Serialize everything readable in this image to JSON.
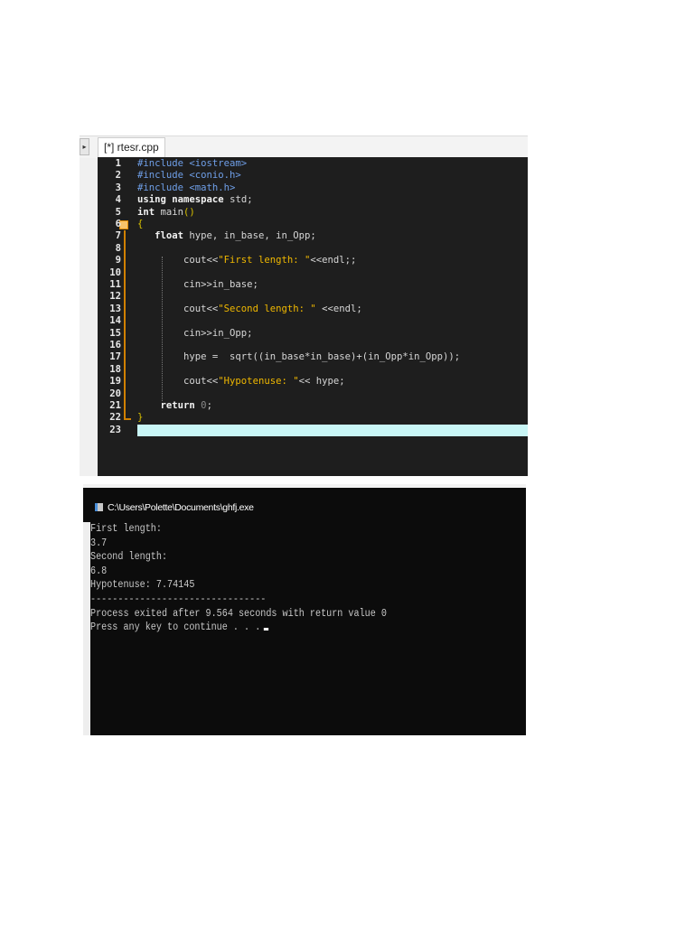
{
  "editor": {
    "tab_label": "[*] rtesr.cpp",
    "lines": [
      {
        "n": "1",
        "tokens": [
          {
            "t": "#include <iostream>",
            "c": "pp"
          }
        ]
      },
      {
        "n": "2",
        "tokens": [
          {
            "t": "#include <conio.h>",
            "c": "pp"
          }
        ]
      },
      {
        "n": "3",
        "tokens": [
          {
            "t": "#include <math.h>",
            "c": "pp"
          }
        ]
      },
      {
        "n": "4",
        "tokens": [
          {
            "t": "using namespace ",
            "c": "kw"
          },
          {
            "t": "std;",
            "c": "id"
          }
        ]
      },
      {
        "n": "5",
        "tokens": [
          {
            "t": "int ",
            "c": "kw"
          },
          {
            "t": "main",
            "c": "id"
          },
          {
            "t": "()",
            "c": "br"
          }
        ]
      },
      {
        "n": "6",
        "tokens": [
          {
            "t": "{",
            "c": "br"
          }
        ]
      },
      {
        "n": "7",
        "tokens": [
          {
            "t": "   float ",
            "c": "kw"
          },
          {
            "t": "hype, in_base, in_Opp;",
            "c": "id"
          }
        ]
      },
      {
        "n": "8",
        "tokens": []
      },
      {
        "n": "9",
        "tokens": [
          {
            "t": "        cout<<",
            "c": "id"
          },
          {
            "t": "\"First length: \"",
            "c": "str"
          },
          {
            "t": "<<endl;;",
            "c": "id"
          }
        ]
      },
      {
        "n": "10",
        "tokens": []
      },
      {
        "n": "11",
        "tokens": [
          {
            "t": "        cin>>in_base;",
            "c": "id"
          }
        ]
      },
      {
        "n": "12",
        "tokens": []
      },
      {
        "n": "13",
        "tokens": [
          {
            "t": "        cout<<",
            "c": "id"
          },
          {
            "t": "\"Second length: \"",
            "c": "str"
          },
          {
            "t": " <<endl;",
            "c": "id"
          }
        ]
      },
      {
        "n": "14",
        "tokens": []
      },
      {
        "n": "15",
        "tokens": [
          {
            "t": "        cin>>in_Opp;",
            "c": "id"
          }
        ]
      },
      {
        "n": "16",
        "tokens": []
      },
      {
        "n": "17",
        "tokens": [
          {
            "t": "        hype =  sqrt((in_base*in_base)+(in_Opp*in_Opp));",
            "c": "id"
          }
        ]
      },
      {
        "n": "18",
        "tokens": []
      },
      {
        "n": "19",
        "tokens": [
          {
            "t": "        cout<<",
            "c": "id"
          },
          {
            "t": "\"Hypotenuse: \"",
            "c": "str"
          },
          {
            "t": "<< hype;",
            "c": "id"
          }
        ]
      },
      {
        "n": "20",
        "tokens": []
      },
      {
        "n": "21",
        "tokens": [
          {
            "t": "    return ",
            "c": "kw"
          },
          {
            "t": "0",
            "c": "num"
          },
          {
            "t": ";",
            "c": "id"
          }
        ]
      },
      {
        "n": "22",
        "tokens": [
          {
            "t": "}",
            "c": "br"
          }
        ]
      },
      {
        "n": "23",
        "tokens": [],
        "highlight": true
      }
    ]
  },
  "console": {
    "title": "C:\\Users\\Polette\\Documents\\ghfj.exe",
    "lines": [
      "First length:",
      "3.7",
      "Second length:",
      "6.8",
      "Hypotenuse: 7.74145",
      "--------------------------------",
      "Process exited after 9.564 seconds with return value 0",
      "Press any key to continue . . ."
    ]
  }
}
